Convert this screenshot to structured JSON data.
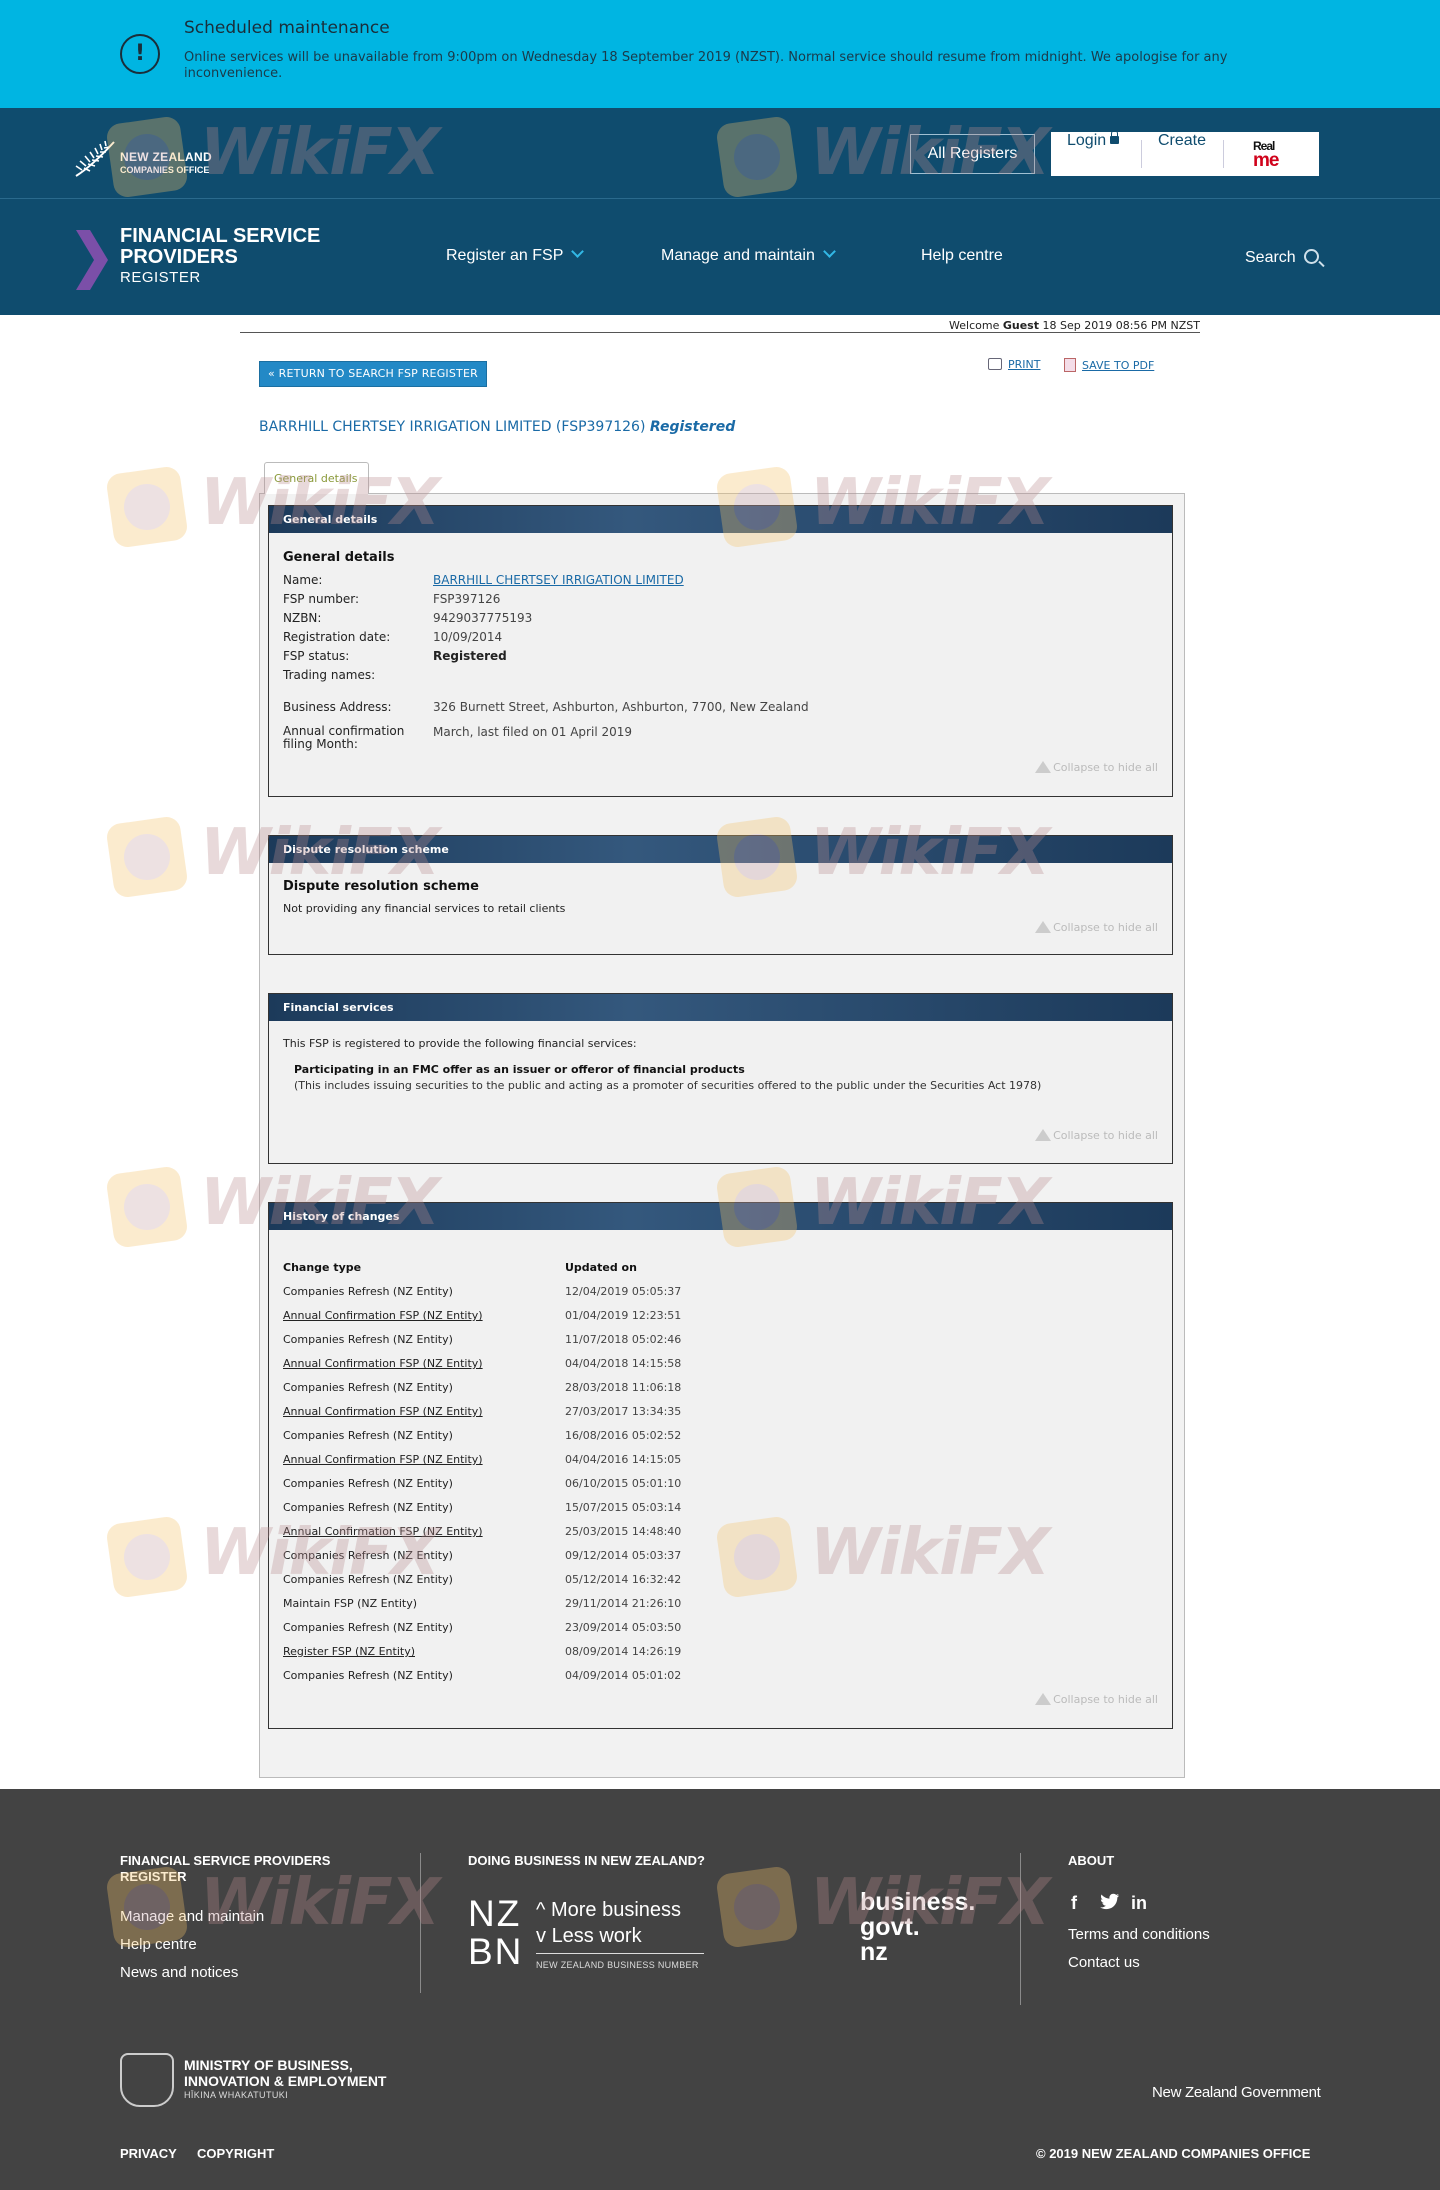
{
  "banner": {
    "title": "Scheduled maintenance",
    "text": "Online services will be unavailable from 9:00pm on Wednesday 18 September 2019 (NZST). Normal service should resume from midnight. We apologise for any inconvenience."
  },
  "header": {
    "logo_line1": "NEW ZEALAND",
    "logo_line2": "COMPANIES OFFICE",
    "all_registers": "All Registers",
    "login": "Login",
    "create": "Create",
    "realme_top": "Real",
    "realme_bottom": "me",
    "register_title_1": "FINANCIAL SERVICE",
    "register_title_2": "PROVIDERS",
    "register_subtitle": "REGISTER",
    "nav": {
      "register": "Register an FSP",
      "manage": "Manage and maintain",
      "help": "Help centre",
      "search": "Search"
    }
  },
  "welcome": {
    "prefix": "Welcome",
    "user": "Guest",
    "datetime": "18 Sep 2019 08:56 PM NZST"
  },
  "actions": {
    "return": "« RETURN TO SEARCH FSP REGISTER",
    "print": "PRINT",
    "save_pdf": "SAVE TO PDF"
  },
  "entity": {
    "name": "BARRHILL CHERTSEY IRRIGATION LIMITED (FSP397126)",
    "status": "Registered"
  },
  "tab_label": "General details",
  "general": {
    "header": "General details",
    "title": "General details",
    "labels": {
      "name": "Name:",
      "fsp_number": "FSP number:",
      "nzbn": "NZBN:",
      "reg_date": "Registration date:",
      "fsp_status": "FSP status:",
      "trading": "Trading names:",
      "address": "Business Address:",
      "annual_1": "Annual confirmation",
      "annual_2": "filing Month:"
    },
    "values": {
      "name": "BARRHILL CHERTSEY IRRIGATION LIMITED",
      "fsp_number": "FSP397126",
      "nzbn": "9429037775193",
      "reg_date": "10/09/2014",
      "fsp_status": "Registered",
      "address": "326 Burnett Street, Ashburton, Ashburton, 7700, New Zealand",
      "annual": "March, last filed on 01 April 2019"
    }
  },
  "collapse_label": "Collapse to hide all",
  "dispute": {
    "header": "Dispute resolution scheme",
    "title": "Dispute resolution scheme",
    "text": "Not providing any financial services to retail clients"
  },
  "financial": {
    "header": "Financial services",
    "intro": "This FSP is registered to provide the following financial services:",
    "service": "Participating in an FMC offer as an issuer or offeror of financial products",
    "note": "(This includes issuing securities to the public and acting as a promoter of securities offered to the public under the Securities Act 1978)"
  },
  "history": {
    "header": "History of changes",
    "col_type": "Change type",
    "col_updated": "Updated on",
    "rows": [
      {
        "type": "Companies Refresh (NZ Entity)",
        "date": "12/04/2019 05:05:37"
      },
      {
        "type": "Annual Confirmation FSP (NZ Entity)",
        "date": "01/04/2019 12:23:51"
      },
      {
        "type": "Companies Refresh (NZ Entity)",
        "date": "11/07/2018 05:02:46"
      },
      {
        "type": "Annual Confirmation FSP (NZ Entity)",
        "date": "04/04/2018 14:15:58"
      },
      {
        "type": "Companies Refresh (NZ Entity)",
        "date": "28/03/2018 11:06:18"
      },
      {
        "type": "Annual Confirmation FSP (NZ Entity)",
        "date": "27/03/2017 13:34:35"
      },
      {
        "type": "Companies Refresh (NZ Entity)",
        "date": "16/08/2016 05:02:52"
      },
      {
        "type": "Annual Confirmation FSP (NZ Entity)",
        "date": "04/04/2016 14:15:05"
      },
      {
        "type": "Companies Refresh (NZ Entity)",
        "date": "06/10/2015 05:01:10"
      },
      {
        "type": "Companies Refresh (NZ Entity)",
        "date": "15/07/2015 05:03:14"
      },
      {
        "type": "Annual Confirmation FSP (NZ Entity)",
        "date": "25/03/2015 14:48:40"
      },
      {
        "type": "Companies Refresh (NZ Entity)",
        "date": "09/12/2014 05:03:37"
      },
      {
        "type": "Companies Refresh (NZ Entity)",
        "date": "05/12/2014 16:32:42"
      },
      {
        "type": "Maintain FSP (NZ Entity)",
        "date": "29/11/2014 21:26:10"
      },
      {
        "type": "Companies Refresh (NZ Entity)",
        "date": "23/09/2014 05:03:50"
      },
      {
        "type": "Register FSP (NZ Entity)",
        "date": "08/09/2014 14:26:19"
      },
      {
        "type": "Companies Refresh (NZ Entity)",
        "date": "04/09/2014 05:01:02"
      }
    ]
  },
  "footer": {
    "col1_h1": "FINANCIAL SERVICE PROVIDERS",
    "col1_h2": "REGISTER",
    "links": [
      "Manage and maintain",
      "Help centre",
      "News and notices"
    ],
    "col2_h": "DOING BUSINESS IN NEW ZEALAND?",
    "nzbn_big_1": "NZ",
    "nzbn_big_2": "BN",
    "nzbn_r1": "More business",
    "nzbn_r2": "Less work",
    "nzbn_sub": "NEW ZEALAND BUSINESS NUMBER",
    "bgov_1": "business.",
    "bgov_2": "govt.",
    "bgov_3": "nz",
    "about_h": "ABOUT",
    "social": [
      "f",
      "t",
      "in"
    ],
    "about_links": [
      "Terms and conditions",
      "Contact us"
    ],
    "mbie_1": "MINISTRY OF BUSINESS,",
    "mbie_2": "INNOVATION & EMPLOYMENT",
    "mbie_3": "HĪKINA WHAKATUTUKI",
    "nzgov": "New Zealand Government",
    "privacy": "PRIVACY",
    "copyright": "COPYRIGHT",
    "copy_notice": "© 2019 NEW ZEALAND COMPANIES OFFICE"
  },
  "watermark": "WikiFX",
  "colors": {
    "banner": "#00b5e2",
    "header": "#0f4c6e",
    "link": "#1a6aa6",
    "footer": "#434343"
  }
}
